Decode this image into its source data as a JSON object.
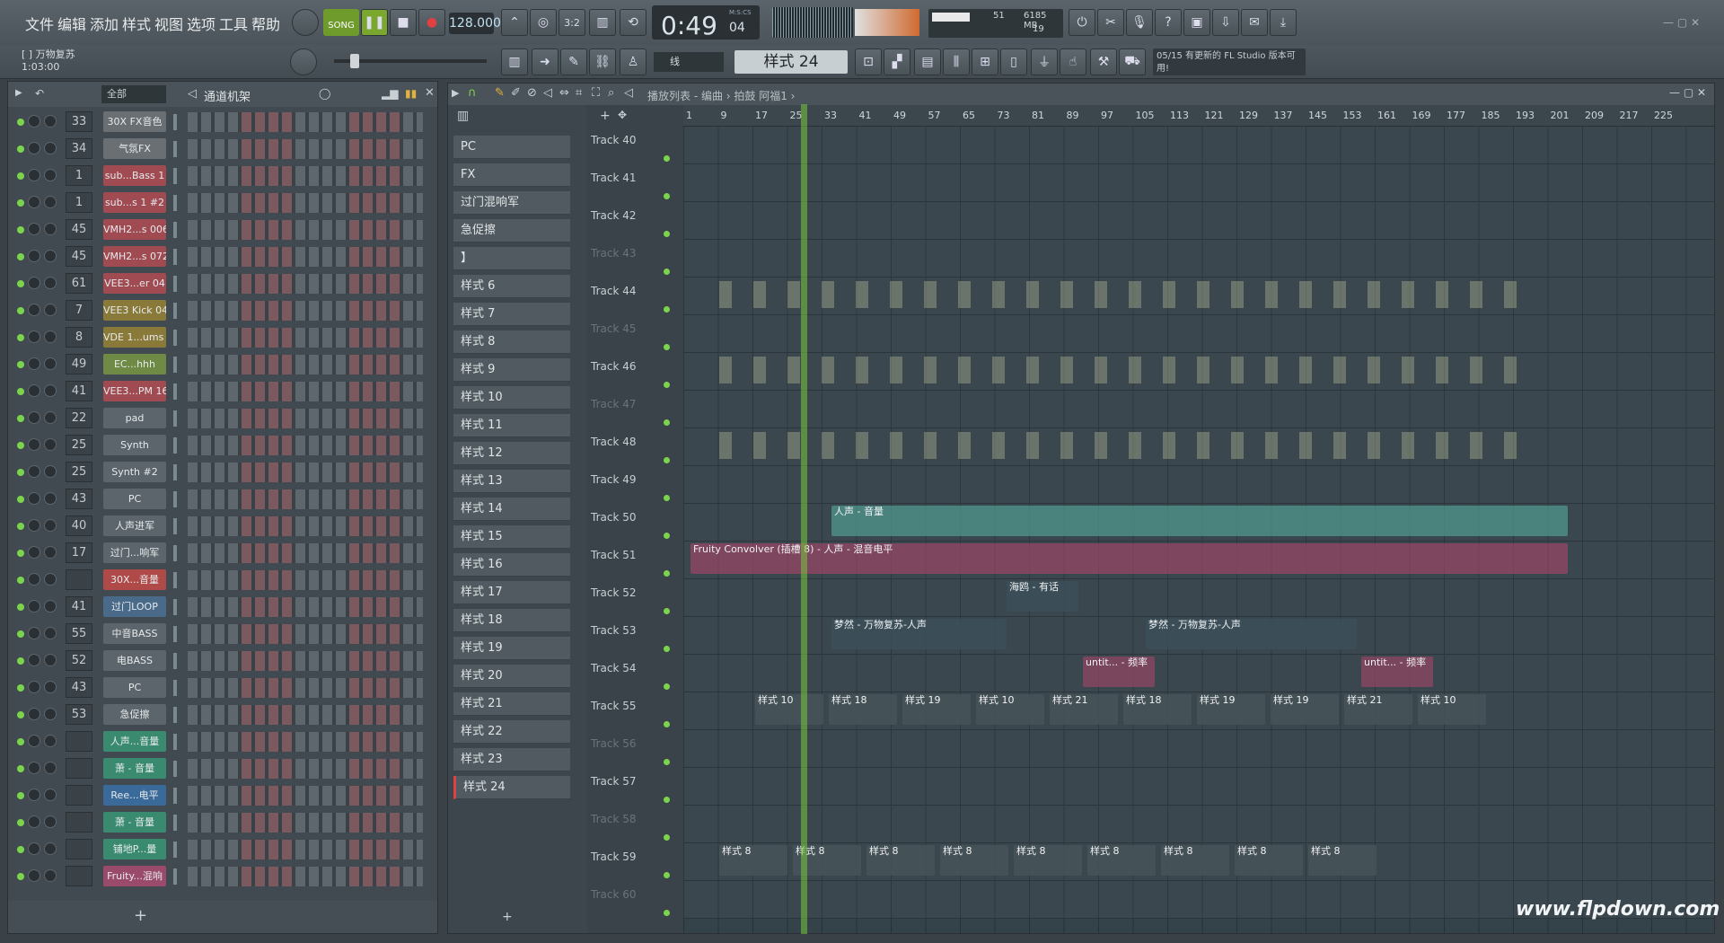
{
  "menu": [
    "文件",
    "编辑",
    "添加",
    "样式",
    "视图",
    "选项",
    "工具",
    "帮助"
  ],
  "transport": {
    "song_label": "SONG",
    "tempo": "128.000",
    "time": "0:49",
    "time_frac": "04",
    "time_unit": "M:S:CS",
    "mem": "6185 MB",
    "cpu": "51",
    "poly": "19"
  },
  "project": {
    "name": "[  ] 万物复苏",
    "position": "1:03:00"
  },
  "toolbar": {
    "pattern": "样式 24",
    "snap": "线",
    "news_count": "05/15",
    "news_text": "有更新的 FL Studio 版本可用!"
  },
  "channel_rack": {
    "filter": "全部",
    "title": "通道机架",
    "rows": [
      {
        "num": "33",
        "name": "30X FX音色",
        "color": "#6a6f74"
      },
      {
        "num": "34",
        "name": "气氛FX",
        "color": "#6a6f74"
      },
      {
        "num": "1",
        "name": "sub...Bass 1",
        "color": "#a04a52"
      },
      {
        "num": "1",
        "name": "sub...s 1 #2",
        "color": "#a04a52"
      },
      {
        "num": "45",
        "name": "VMH2...s 006",
        "color": "#a04a52"
      },
      {
        "num": "45",
        "name": "VMH2...s 072",
        "color": "#a04a52"
      },
      {
        "num": "61",
        "name": "VEE3...er 04",
        "color": "#a04a52"
      },
      {
        "num": "7",
        "name": "VEE3 Kick 04",
        "color": "#8a7a3a"
      },
      {
        "num": "8",
        "name": "VDE 1...ums 6",
        "color": "#8a7a3a"
      },
      {
        "num": "49",
        "name": "EC...hhh",
        "color": "#6f8a44"
      },
      {
        "num": "41",
        "name": "VEE3...PM 16",
        "color": "#a04a52"
      },
      {
        "num": "22",
        "name": "pad",
        "color": "#5c656b"
      },
      {
        "num": "25",
        "name": "Synth",
        "color": "#5c656b"
      },
      {
        "num": "25",
        "name": "Synth #2",
        "color": "#5c656b"
      },
      {
        "num": "43",
        "name": "PC",
        "color": "#5c656b"
      },
      {
        "num": "40",
        "name": "人声进军",
        "color": "#5c656b"
      },
      {
        "num": "17",
        "name": "过门...响军",
        "color": "#5c656b"
      },
      {
        "num": "",
        "name": "30X...音量",
        "color": "#b04a48"
      },
      {
        "num": "41",
        "name": "过门LOOP",
        "color": "#4a6a8a"
      },
      {
        "num": "55",
        "name": "中音BASS",
        "color": "#5c656b"
      },
      {
        "num": "52",
        "name": "电BASS",
        "color": "#5c656b"
      },
      {
        "num": "43",
        "name": "PC",
        "color": "#5c656b"
      },
      {
        "num": "53",
        "name": "急促擦",
        "color": "#5c656b"
      },
      {
        "num": "",
        "name": "人声...音量",
        "color": "#3a8a70"
      },
      {
        "num": "",
        "name": "萧 - 音量",
        "color": "#3a8a70"
      },
      {
        "num": "",
        "name": "Ree...电平",
        "color": "#3a6a9a"
      },
      {
        "num": "",
        "name": "萧 - 音量",
        "color": "#3a8a70"
      },
      {
        "num": "",
        "name": "铺地P...量",
        "color": "#3a8a70"
      },
      {
        "num": "",
        "name": "Fruity...混响",
        "color": "#9a4a6a"
      }
    ]
  },
  "playlist": {
    "breadcrumb": "播放列表 - 编曲 › 拍鼓 阿福1 ›",
    "patterns": [
      "PC",
      "FX",
      "过门混响军",
      "急促擦",
      "】",
      "样式 6",
      "样式 7",
      "样式 8",
      "样式 9",
      "样式 10",
      "样式 11",
      "样式 12",
      "样式 13",
      "样式 14",
      "样式 15",
      "样式 16",
      "样式 17",
      "样式 18",
      "样式 19",
      "样式 20",
      "样式 21",
      "样式 22",
      "样式 23",
      "样式 24"
    ],
    "ruler": [
      "1",
      "9",
      "17",
      "25",
      "33",
      "41",
      "49",
      "57",
      "65",
      "73",
      "81",
      "89",
      "97",
      "105",
      "113",
      "121",
      "129",
      "137",
      "145",
      "153",
      "161",
      "169",
      "177",
      "185",
      "193",
      "201",
      "209",
      "217",
      "225"
    ],
    "tracks": [
      "Track 40",
      "Track 41",
      "Track 42",
      "Track 43",
      "Track 44",
      "Track 45",
      "Track 46",
      "Track 47",
      "Track 48",
      "Track 49",
      "Track 50",
      "Track 51",
      "Track 52",
      "Track 53",
      "Track 54",
      "Track 55",
      "Track 56",
      "Track 57",
      "Track 58",
      "Track 59",
      "Track 60"
    ],
    "clips": {
      "vocal_vol": "人声 - 音量",
      "convolver": "Fruity Convolver (插槽 8) - 人声 - 混音电平",
      "haiou": "海鸥 - 有话",
      "mengran1": "梦然 - 万物复苏-人声",
      "mengran2": "梦然 - 万物复苏-人声",
      "untit1": "untit... - 频率",
      "untit2": "untit... - 频率",
      "p55": [
        "样式 10",
        "样式 18",
        "样式 19",
        "样式 10",
        "样式 21",
        "样式 18",
        "样式 19",
        "样式 19",
        "样式 21",
        "样式 10"
      ],
      "p59": [
        "样式 8",
        "样式 8",
        "样式 8",
        "样式 8",
        "样式 8",
        "样式 8",
        "样式 8",
        "样式 8",
        "样式 8"
      ]
    }
  },
  "watermark": "www.flpdown.com"
}
